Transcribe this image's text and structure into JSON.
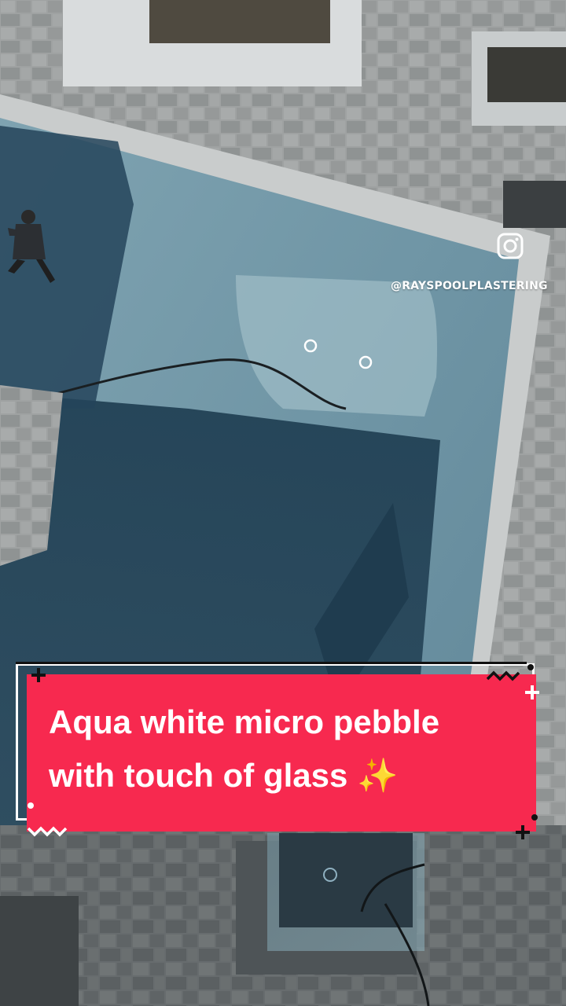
{
  "overlay": {
    "instagram_handle": "@RAYSPOOLPLASTERING",
    "instagram_icon": "instagram-icon"
  },
  "caption": {
    "line1": "Aqua white micro pebble",
    "line2": "with touch of glass ✨",
    "background_color": "#f7294f",
    "text_color": "#ffffff"
  }
}
